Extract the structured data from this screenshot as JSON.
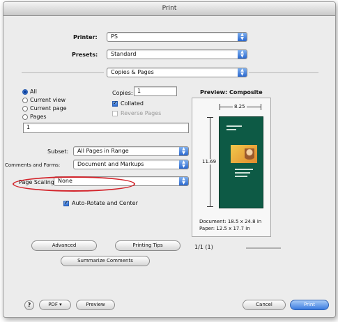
{
  "window": {
    "title": "Print"
  },
  "printer": {
    "label": "Printer:",
    "value": "PS"
  },
  "presets": {
    "label": "Presets:",
    "value": "Standard"
  },
  "panel": {
    "value": "Copies & Pages"
  },
  "range": {
    "options": [
      {
        "label": "All",
        "selected": true
      },
      {
        "label": "Current view",
        "selected": false
      },
      {
        "label": "Current page",
        "selected": false
      },
      {
        "label": "Pages",
        "selected": false
      }
    ],
    "pages_value": "1"
  },
  "copies": {
    "label": "Copies:",
    "value": "1"
  },
  "collated": {
    "label": "Collated",
    "checked": true
  },
  "reverse_pages": {
    "label": "Reverse Pages",
    "checked": false,
    "enabled": false
  },
  "subset": {
    "label": "Subset:",
    "value": "All Pages in Range"
  },
  "comments_forms": {
    "label": "Comments and Forms:",
    "value": "Document and Markups"
  },
  "page_scaling": {
    "label": "Page Scaling:",
    "value": "None"
  },
  "auto_rotate": {
    "label": "Auto-Rotate and Center",
    "checked": true
  },
  "preview": {
    "title": "Preview: Composite",
    "width_dim": "8.25",
    "height_dim": "11.69",
    "document_size": "Document: 18.5 x 24.8 in",
    "paper_size": "Paper: 12.5 x 17.7 in",
    "page_counter": "1/1 (1)"
  },
  "buttons": {
    "advanced": "Advanced",
    "printing_tips": "Printing Tips",
    "summarize_comments": "Summarize Comments",
    "help": "?",
    "pdf": "PDF ▾",
    "preview": "Preview",
    "cancel": "Cancel",
    "print": "Print"
  },
  "colors": {
    "accent": "#3a7be0",
    "annotation": "#d3232a",
    "doc_page": "#0d5a45"
  }
}
